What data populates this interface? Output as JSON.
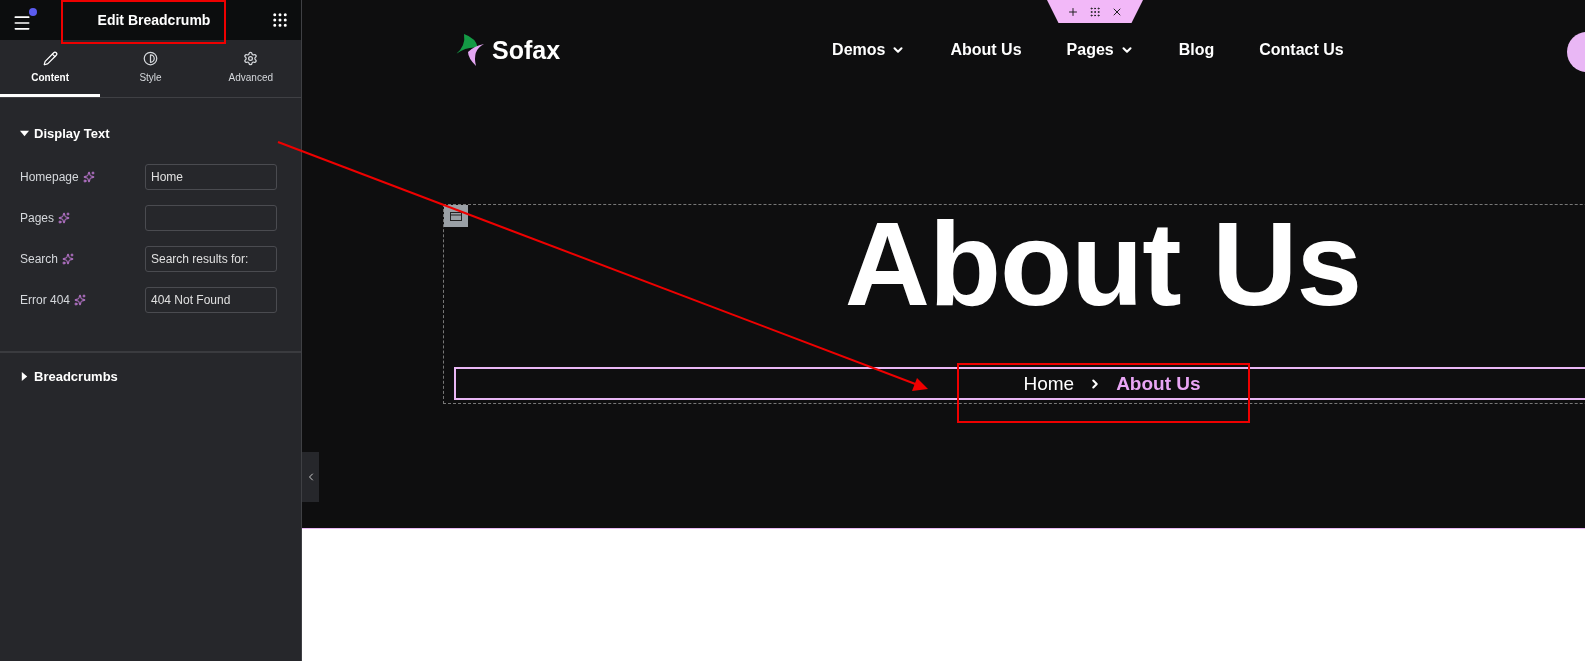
{
  "panel": {
    "title": "Edit Breadcrumb",
    "has_notification": true,
    "tabs": [
      {
        "label": "Content",
        "selected": true
      },
      {
        "label": "Style",
        "selected": false
      },
      {
        "label": "Advanced",
        "selected": false
      }
    ],
    "sections": [
      {
        "title": "Display Text",
        "expanded": true,
        "fields": [
          {
            "label": "Homepage",
            "value": "Home"
          },
          {
            "label": "Pages"
          },
          {
            "label": "Search",
            "value": "Search results for:"
          },
          {
            "label": "Error 404",
            "value": "404 Not Found"
          }
        ]
      },
      {
        "title": "Breadcrumbs",
        "expanded": false
      }
    ]
  },
  "site": {
    "logo": "Sofax",
    "nav": [
      {
        "label": "Demos",
        "dropdown": true
      },
      {
        "label": "About Us",
        "dropdown": false
      },
      {
        "label": "Pages",
        "dropdown": true
      },
      {
        "label": "Blog",
        "dropdown": false
      },
      {
        "label": "Contact Us",
        "dropdown": false
      }
    ],
    "hero_title": "About Us",
    "breadcrumb": [
      {
        "label": "Home",
        "current": false
      },
      {
        "label": "About Us",
        "current": true
      }
    ]
  }
}
